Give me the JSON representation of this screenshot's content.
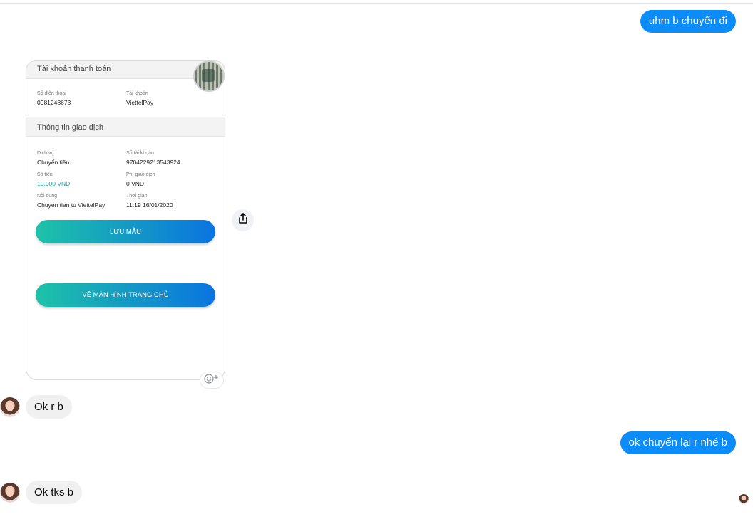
{
  "messages": {
    "out1": "uhm b chuyển đi",
    "in1": "Ok r b",
    "out2": "ok chuyển lại r nhé b",
    "in2": "Ok tks b"
  },
  "receipt": {
    "account_header": "Tài khoản thanh toán",
    "phone_label": "Số điện thoại",
    "phone_value": "0981248673",
    "account_label": "Tài khoản",
    "account_value": "ViettelPay",
    "txn_header": "Thông tin giao dịch",
    "service_label": "Dịch vụ",
    "service_value": "Chuyển tiền",
    "accnum_label": "Số tài khoản",
    "accnum_value": "9704229213543924",
    "amount_label": "Số tiền",
    "amount_value": "10.000 VND",
    "fee_label": "Phí giao dịch",
    "fee_value": "0 VND",
    "content_label": "Nội dung",
    "content_value": "Chuyen tien tu ViettelPay",
    "time_label": "Thời gian",
    "time_value": "11:19 16/01/2020",
    "save_button": "LƯU MẪU",
    "home_button": "VỀ MÀN HÌNH TRANG CHỦ"
  },
  "icons": {
    "share": "share-icon",
    "react": "add-reaction-icon",
    "avatar": "contact-avatar"
  },
  "colors": {
    "outgoing_bubble": "#0b8cf9",
    "incoming_bubble": "#f0f0f0",
    "amount_text": "#19a4a4"
  }
}
